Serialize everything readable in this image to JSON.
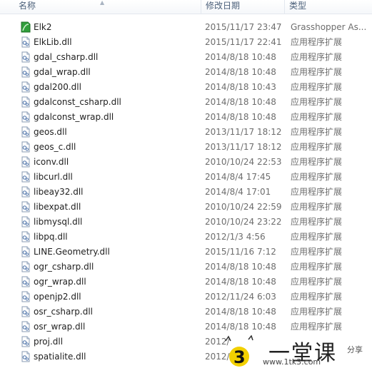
{
  "header": {
    "name": "名称",
    "date": "修改日期",
    "type": "类型"
  },
  "files": [
    {
      "name": "Elk2",
      "date": "2015/11/17 23:47",
      "type": "Grasshopper As...",
      "icon": "grasshopper-icon"
    },
    {
      "name": "ElkLib.dll",
      "date": "2015/11/17 22:41",
      "type": "应用程序扩展",
      "icon": "dll-file-icon"
    },
    {
      "name": "gdal_csharp.dll",
      "date": "2014/8/18 10:48",
      "type": "应用程序扩展",
      "icon": "dll-file-icon"
    },
    {
      "name": "gdal_wrap.dll",
      "date": "2014/8/18 10:48",
      "type": "应用程序扩展",
      "icon": "dll-file-icon"
    },
    {
      "name": "gdal200.dll",
      "date": "2014/8/18 10:43",
      "type": "应用程序扩展",
      "icon": "dll-file-icon"
    },
    {
      "name": "gdalconst_csharp.dll",
      "date": "2014/8/18 10:48",
      "type": "应用程序扩展",
      "icon": "dll-file-icon"
    },
    {
      "name": "gdalconst_wrap.dll",
      "date": "2014/8/18 10:48",
      "type": "应用程序扩展",
      "icon": "dll-file-icon"
    },
    {
      "name": "geos.dll",
      "date": "2013/11/17 18:12",
      "type": "应用程序扩展",
      "icon": "dll-file-icon"
    },
    {
      "name": "geos_c.dll",
      "date": "2013/11/17 18:12",
      "type": "应用程序扩展",
      "icon": "dll-file-icon"
    },
    {
      "name": "iconv.dll",
      "date": "2010/10/24 22:53",
      "type": "应用程序扩展",
      "icon": "dll-file-icon"
    },
    {
      "name": "libcurl.dll",
      "date": "2014/8/4 17:45",
      "type": "应用程序扩展",
      "icon": "dll-file-icon"
    },
    {
      "name": "libeay32.dll",
      "date": "2014/8/4 17:01",
      "type": "应用程序扩展",
      "icon": "dll-file-icon"
    },
    {
      "name": "libexpat.dll",
      "date": "2010/10/24 22:59",
      "type": "应用程序扩展",
      "icon": "dll-file-icon"
    },
    {
      "name": "libmysql.dll",
      "date": "2010/10/24 23:22",
      "type": "应用程序扩展",
      "icon": "dll-file-icon"
    },
    {
      "name": "libpq.dll",
      "date": "2012/1/3 4:56",
      "type": "应用程序扩展",
      "icon": "dll-file-icon"
    },
    {
      "name": "LINE.Geometry.dll",
      "date": "2015/11/16 7:12",
      "type": "应用程序扩展",
      "icon": "dll-file-icon"
    },
    {
      "name": "ogr_csharp.dll",
      "date": "2014/8/18 10:48",
      "type": "应用程序扩展",
      "icon": "dll-file-icon"
    },
    {
      "name": "ogr_wrap.dll",
      "date": "2014/8/18 10:48",
      "type": "应用程序扩展",
      "icon": "dll-file-icon"
    },
    {
      "name": "openjp2.dll",
      "date": "2012/11/24 6:03",
      "type": "应用程序扩展",
      "icon": "dll-file-icon"
    },
    {
      "name": "osr_csharp.dll",
      "date": "2014/8/18 10:48",
      "type": "应用程序扩展",
      "icon": "dll-file-icon"
    },
    {
      "name": "osr_wrap.dll",
      "date": "2014/8/18 10:48",
      "type": "应用程序扩展",
      "icon": "dll-file-icon"
    },
    {
      "name": "proj.dll",
      "date": "2012/",
      "type": "",
      "icon": "dll-file-icon"
    },
    {
      "name": "spatialite.dll",
      "date": "2012/1",
      "type": "",
      "icon": "dll-file-icon"
    }
  ],
  "watermark": {
    "brand": "一堂课",
    "slogan": "分享",
    "url": "www.1tk3.com"
  }
}
